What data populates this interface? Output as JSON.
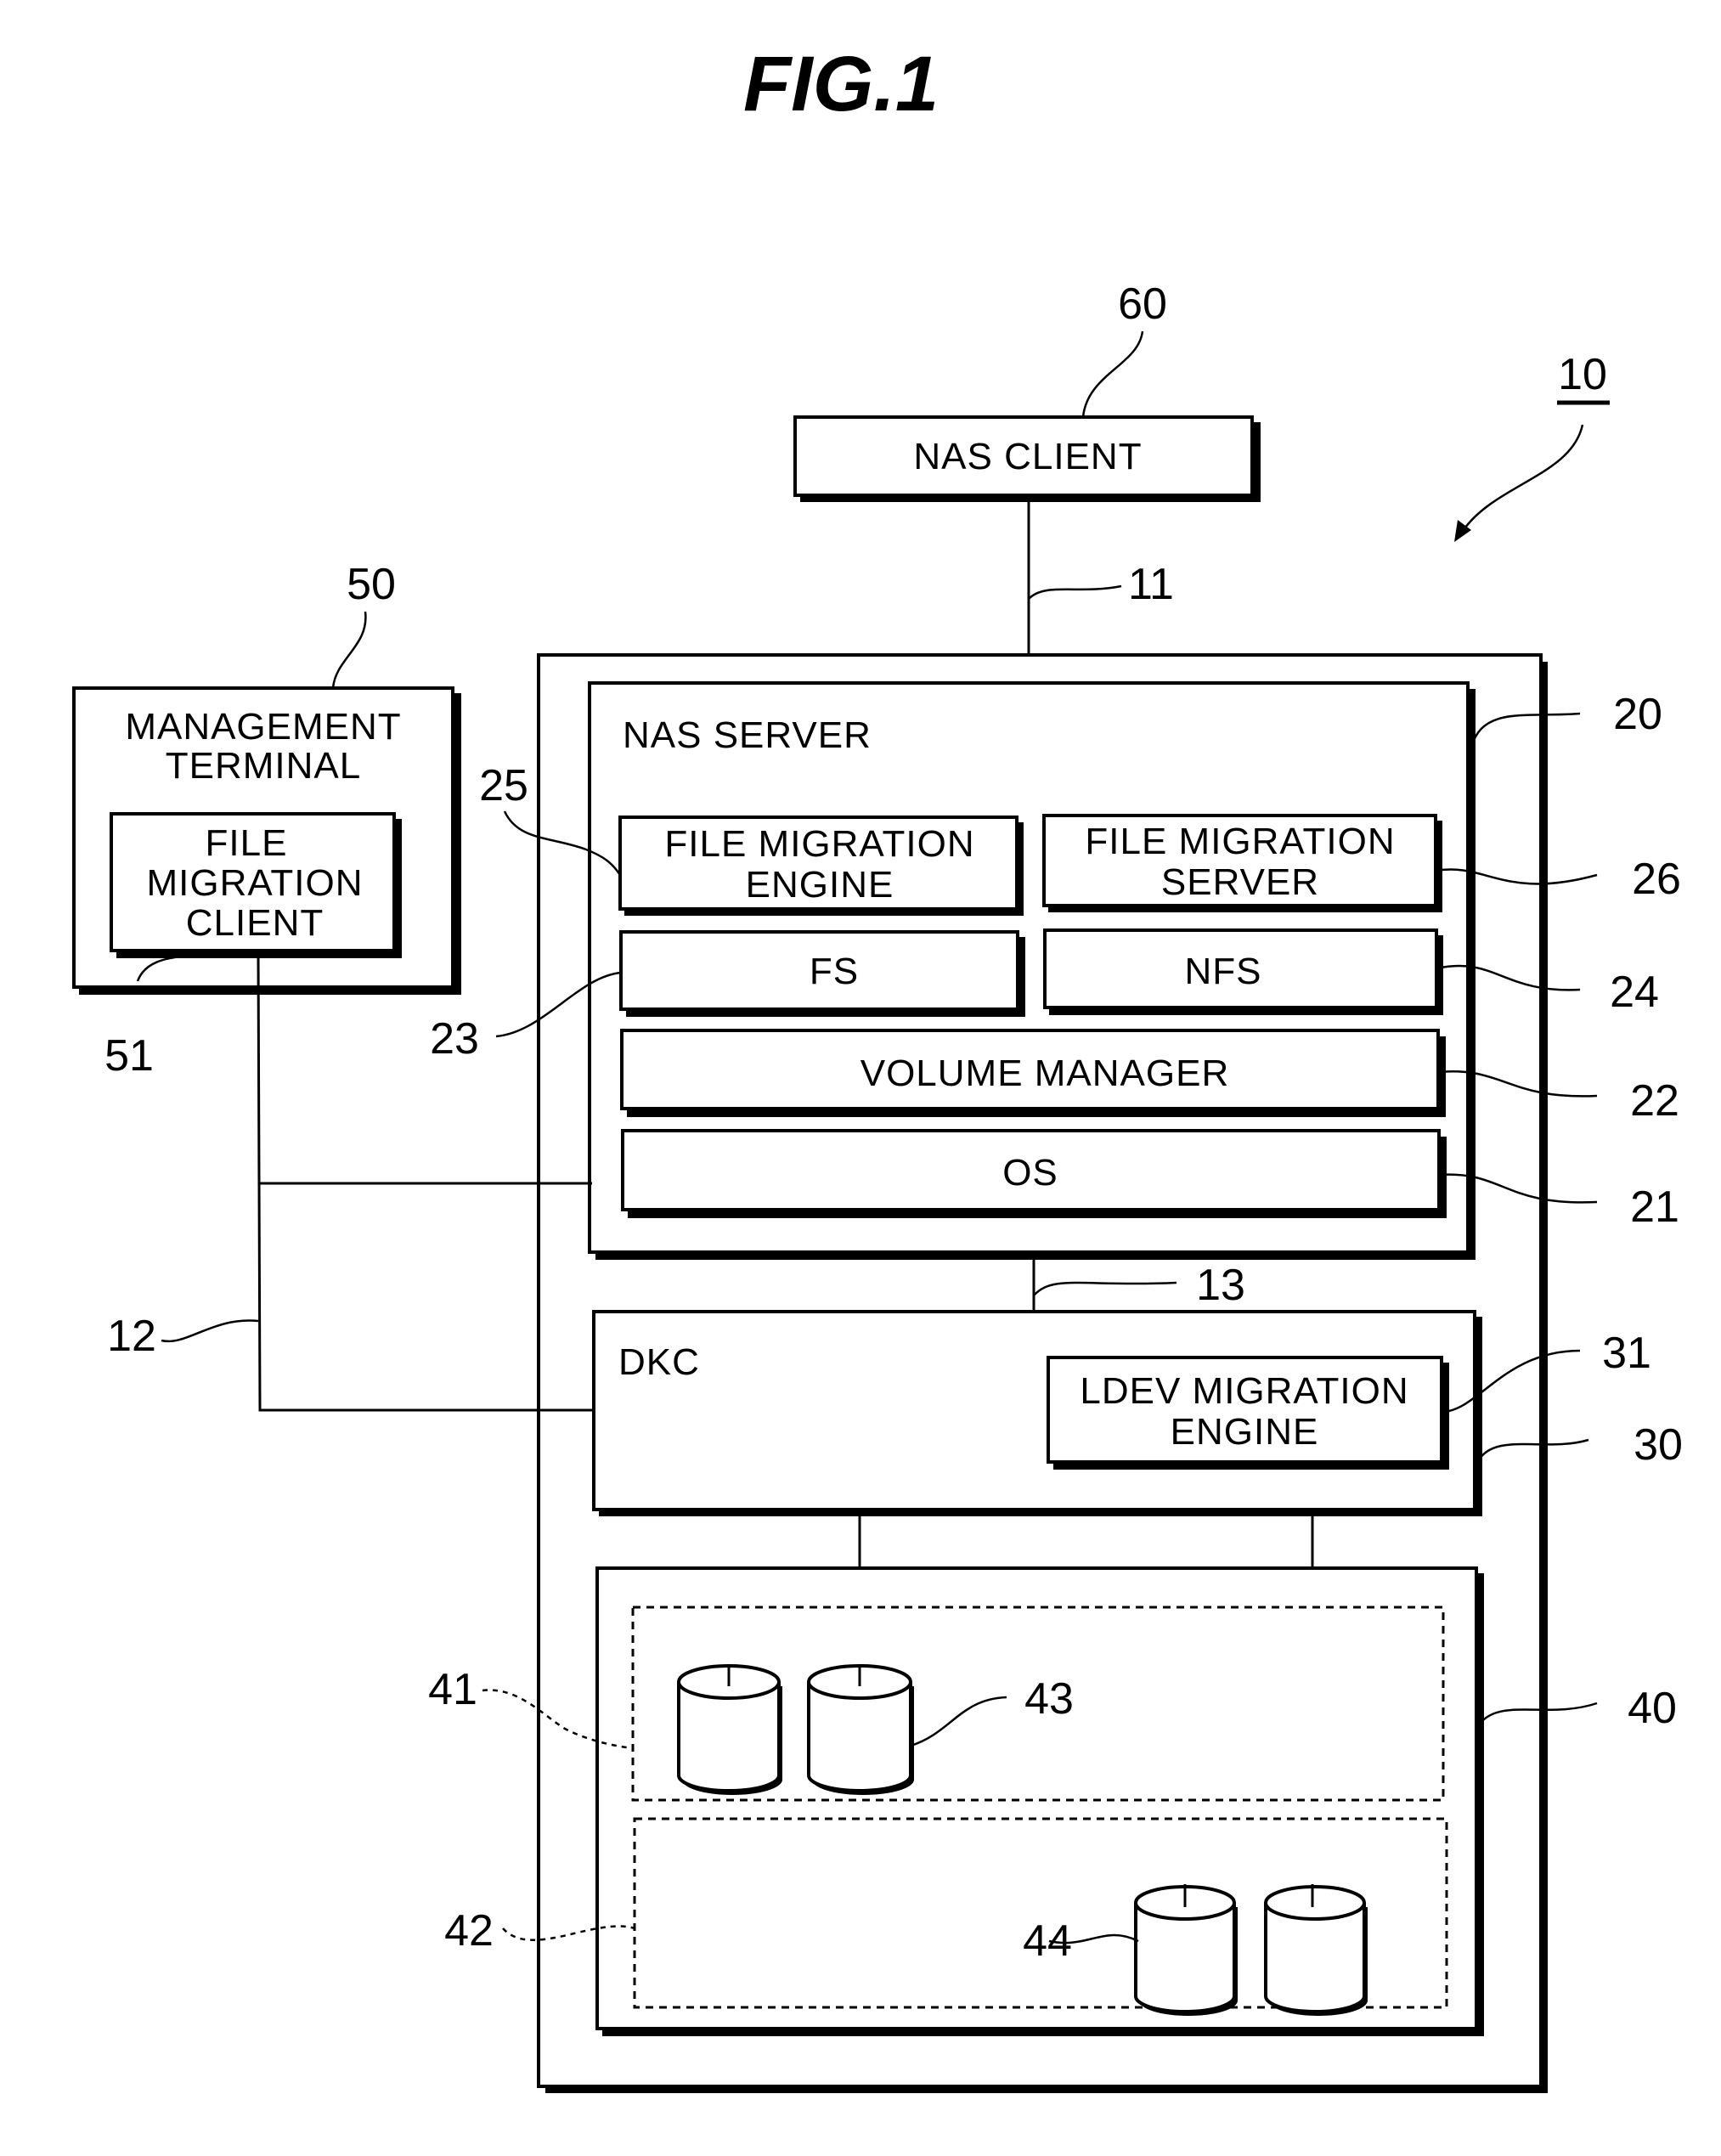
{
  "figure": {
    "title": "FIG.1",
    "system_ref": "10"
  },
  "nas_client": {
    "label": "NAS CLIENT",
    "ref": "60"
  },
  "links": {
    "client_to_server": "11",
    "management_network": "12",
    "server_to_dkc": "13"
  },
  "management_terminal": {
    "label_lines": [
      "MANAGEMENT",
      "TERMINAL"
    ],
    "ref": "50",
    "file_migration_client": {
      "label_lines": [
        "FILE",
        "MIGRATION",
        "CLIENT"
      ],
      "ref": "51"
    }
  },
  "nas_server": {
    "label": "NAS SERVER",
    "ref": "20",
    "components": {
      "file_migration_engine": {
        "label_lines": [
          "FILE  MIGRATION",
          "ENGINE"
        ],
        "ref": "25"
      },
      "file_migration_server": {
        "label_lines": [
          "FILE  MIGRATION",
          "SERVER"
        ],
        "ref": "26"
      },
      "fs": {
        "label": "FS",
        "ref": "23"
      },
      "nfs": {
        "label": "NFS",
        "ref": "24"
      },
      "volume_manager": {
        "label": "VOLUME  MANAGER",
        "ref": "22"
      },
      "os": {
        "label": "OS",
        "ref": "21"
      }
    }
  },
  "dkc": {
    "label": "DKC",
    "ref": "30",
    "ldev_migration_engine": {
      "label_lines": [
        "LDEV  MIGRATION",
        "ENGINE"
      ],
      "ref": "31"
    }
  },
  "storage": {
    "ref": "40",
    "group_1": {
      "ref": "41",
      "disks_ref": "43"
    },
    "group_2": {
      "ref": "42",
      "disks_ref": "44"
    }
  }
}
